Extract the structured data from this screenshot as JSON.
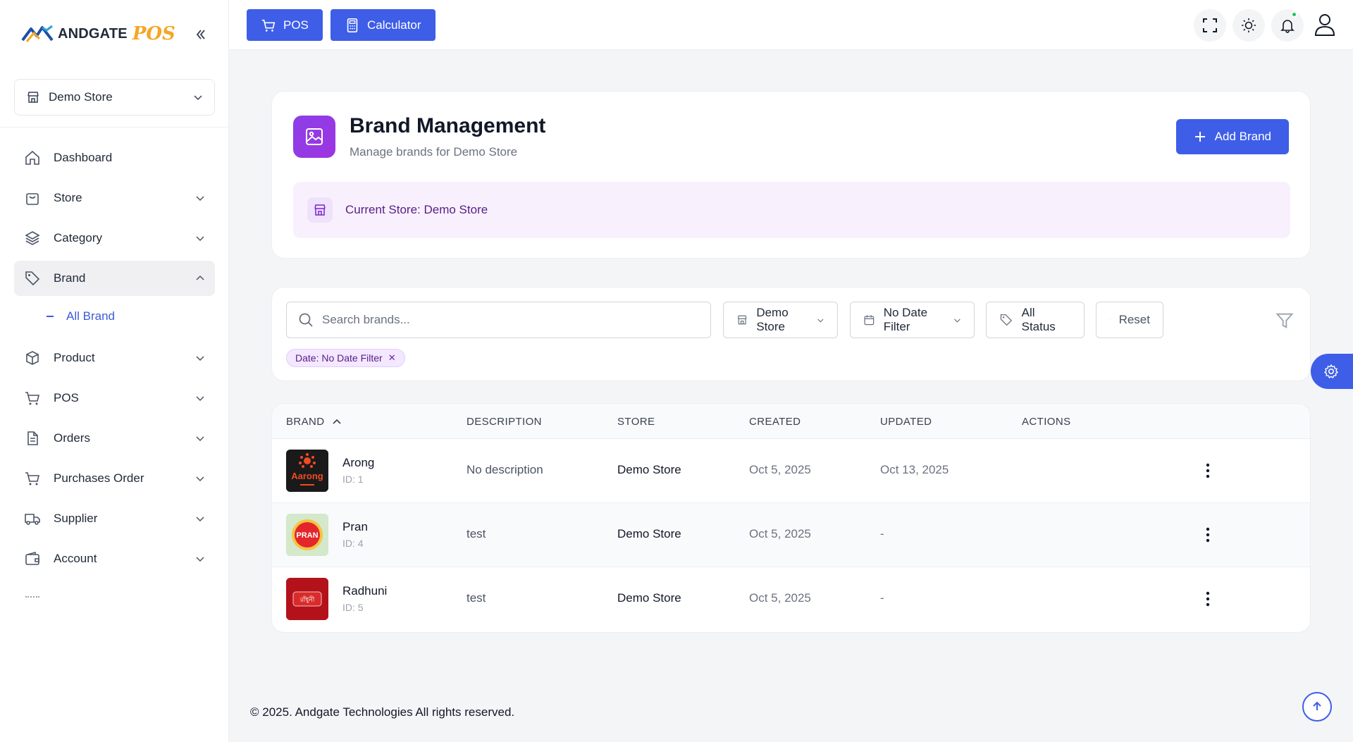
{
  "brand": {
    "name": "ANDGATE",
    "pos": "POS",
    "accent": "#3e5ee8",
    "purple": "#8b3fe8"
  },
  "sidebar": {
    "store_selector": "Demo Store",
    "items": [
      {
        "label": "Dashboard",
        "icon": "home-icon"
      },
      {
        "label": "Store",
        "icon": "bag-icon"
      },
      {
        "label": "Category",
        "icon": "layers-icon"
      },
      {
        "label": "Brand",
        "icon": "tag-icon"
      },
      {
        "label": "Product",
        "icon": "box-icon"
      },
      {
        "label": "POS",
        "icon": "cart-icon"
      },
      {
        "label": "Orders",
        "icon": "document-icon"
      },
      {
        "label": "Purchases Order",
        "icon": "cart-icon"
      },
      {
        "label": "Supplier",
        "icon": "truck-icon"
      },
      {
        "label": "Account",
        "icon": "wallet-icon"
      }
    ],
    "sub_item": "All Brand"
  },
  "topbar": {
    "pos_label": "POS",
    "calculator_label": "Calculator"
  },
  "header": {
    "title": "Brand Management",
    "subtitle": "Manage brands for Demo Store",
    "add_button": "Add Brand",
    "current_store": "Current Store: Demo Store"
  },
  "filters": {
    "search_placeholder": "Search brands...",
    "store": "Demo Store",
    "date": "No Date Filter",
    "status": "All Status",
    "reset": "Reset",
    "chip": "Date: No Date Filter"
  },
  "table": {
    "columns": [
      "BRAND",
      "DESCRIPTION",
      "STORE",
      "CREATED",
      "UPDATED",
      "ACTIONS"
    ],
    "rows": [
      {
        "name": "Arong",
        "id": "ID: 1",
        "description": "No description",
        "store": "Demo Store",
        "created": "Oct 5, 2025",
        "updated": "Oct 13, 2025",
        "logo_text": "Aarong"
      },
      {
        "name": "Pran",
        "id": "ID: 4",
        "description": "test",
        "store": "Demo Store",
        "created": "Oct 5, 2025",
        "updated": "-",
        "logo_text": "PRAN"
      },
      {
        "name": "Radhuni",
        "id": "ID: 5",
        "description": "test",
        "store": "Demo Store",
        "created": "Oct 5, 2025",
        "updated": "-",
        "logo_text": "রাঁধুনী"
      }
    ]
  },
  "footer": "© 2025. Andgate Technologies All rights reserved."
}
